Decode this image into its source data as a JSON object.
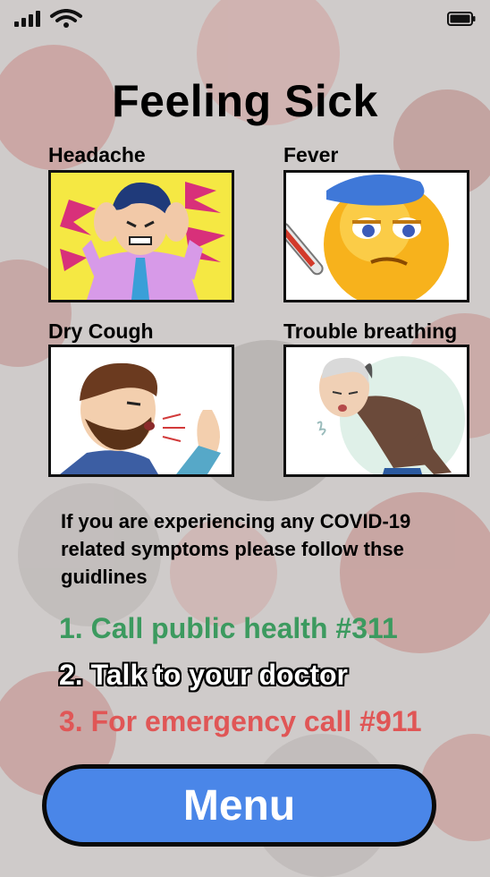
{
  "status_bar": {
    "signal_icon": "signal-bars-icon",
    "wifi_icon": "wifi-icon",
    "battery_icon": "battery-icon"
  },
  "page_title": "Feeling Sick",
  "symptoms": [
    {
      "label": "Headache",
      "illustration": "headache-illustration"
    },
    {
      "label": "Fever",
      "illustration": "fever-emoji-illustration"
    },
    {
      "label": "Dry Cough",
      "illustration": "cough-illustration"
    },
    {
      "label": "Trouble breathing",
      "illustration": "breathing-illustration"
    }
  ],
  "info_text": "If you are experiencing any COVID-19 related symptoms please follow thse guidlines",
  "steps": [
    {
      "text": "1. Call public health #311",
      "color": "#3c9a5f"
    },
    {
      "text": "2. Talk to your doctor",
      "color": "#ffffff"
    },
    {
      "text": "3. For emergency call #911",
      "color": "#e05656"
    }
  ],
  "menu_button": {
    "label": "Menu",
    "color": "#4a86e8"
  }
}
